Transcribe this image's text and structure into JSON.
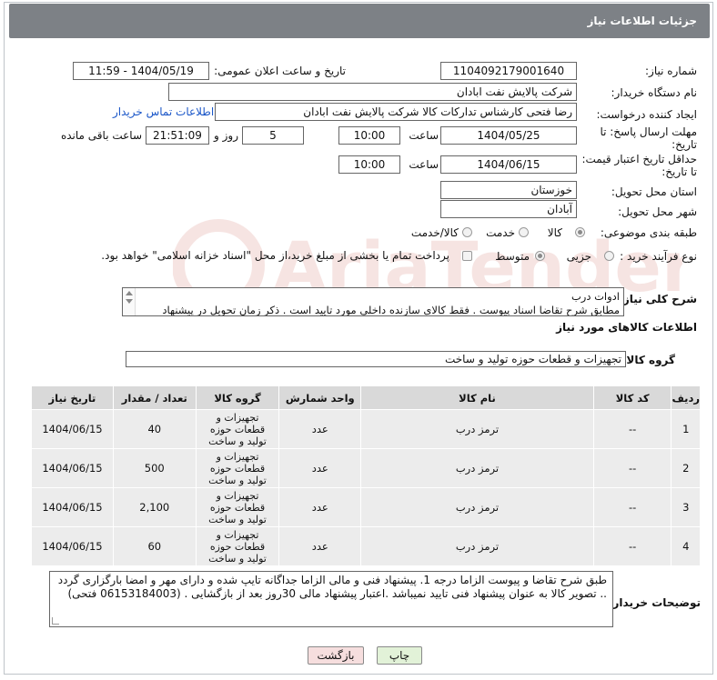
{
  "header": {
    "title": "جزئیات اطلاعات نیاز"
  },
  "form": {
    "need_number_label": "شماره نیاز:",
    "need_number": "1104092179001640",
    "announce_label": "تاریخ و ساعت اعلان عمومی:",
    "announce_value": "1404/05/19 - 11:59",
    "buyer_org_label": "نام دستگاه خریدار:",
    "buyer_org": "شرکت پالایش نفت ابادان",
    "creator_label": "ایجاد کننده درخواست:",
    "creator": "رضا فتحی کارشناس تدارکات کالا  شرکت پالایش نفت ابادان",
    "contact_link": "اطلاعات تماس خریدار",
    "deadline_label_1": "مهلت ارسال پاسخ: تا",
    "deadline_label_2": "تاریخ:",
    "deadline_date": "1404/05/25",
    "time_label": "ساعت",
    "deadline_time": "10:00",
    "days_value": "5",
    "days_label": "روز و",
    "remaining_value": "21:51:09",
    "remaining_label": "ساعت باقی مانده",
    "validity_label_1": "حداقل تاریخ اعتبار قیمت:",
    "validity_label_2": "تا تاریخ:",
    "validity_date": "1404/06/15",
    "validity_time": "10:00",
    "province_label": "استان محل تحویل:",
    "province": "خوزستان",
    "city_label": "شهر محل تحویل:",
    "city": "آبادان",
    "category_label": "طبقه بندی موضوعی:",
    "category_options": [
      "کالا",
      "خدمت",
      "کالا/خدمت"
    ],
    "process_label": "نوع فرآیند خرید :",
    "process_options": [
      "جزیی",
      "متوسط"
    ],
    "payment_note": "پرداخت تمام یا بخشی از مبلغ خرید،از محل \"اسناد خزانه اسلامی\" خواهد بود."
  },
  "description": {
    "label": "شرح کلی نیاز:",
    "line1": "ادوات درب",
    "line2": "مطابق شرح تقاضا اسناد پیوست . فقط کالای سازنده داخلی مورد تایید است . ذکر زمان تحویل در پیشنهاد"
  },
  "goods": {
    "section_title": "اطلاعات کالاهای مورد نیاز",
    "group_label": "گروه کالا:",
    "group_value": "تجهیزات و قطعات حوزه تولید و ساخت",
    "columns": [
      "ردیف",
      "کد کالا",
      "نام کالا",
      "واحد شمارش",
      "گروه کالا",
      "تعداد / مقدار",
      "تاریخ نیاز"
    ],
    "rows": [
      {
        "idx": "1",
        "code": "--",
        "name": "ترمز درب",
        "unit": "عدد",
        "group": "تجهیزات و قطعات حوزه تولید و ساخت",
        "qty": "40",
        "date": "1404/06/15"
      },
      {
        "idx": "2",
        "code": "--",
        "name": "ترمز درب",
        "unit": "عدد",
        "group": "تجهیزات و قطعات حوزه تولید و ساخت",
        "qty": "500",
        "date": "1404/06/15"
      },
      {
        "idx": "3",
        "code": "--",
        "name": "ترمز درب",
        "unit": "عدد",
        "group": "تجهیزات و قطعات حوزه تولید و ساخت",
        "qty": "2,100",
        "date": "1404/06/15"
      },
      {
        "idx": "4",
        "code": "--",
        "name": "ترمز درب",
        "unit": "عدد",
        "group": "تجهیزات و قطعات حوزه تولید و ساخت",
        "qty": "60",
        "date": "1404/06/15"
      }
    ]
  },
  "buyer_notes": {
    "label": "توضیحات خریدار:",
    "text": "طبق شرح تقاضا و پیوست الزاما درجه 1. پیشنهاد فنی و مالی الزاما جداگانه تایپ شده و دارای مهر و امضا بارگزاری گردد .. تصویر کالا به عنوان پیشنهاد فنی تایید نمیباشد .اعتبار پیشنهاد مالی 30روز بعد از بازگشایی . (06153184003 فتحی)"
  },
  "buttons": {
    "print": "چاپ",
    "back": "بازگشت"
  },
  "watermark": {
    "text": "AriaTender.neT",
    "color": "#c0392b"
  },
  "colors": {
    "header_bg": "#7d8186",
    "link": "#1a56c8",
    "back_button_bg": "#f6dede",
    "print_button_bg": "#e2f2d8"
  }
}
